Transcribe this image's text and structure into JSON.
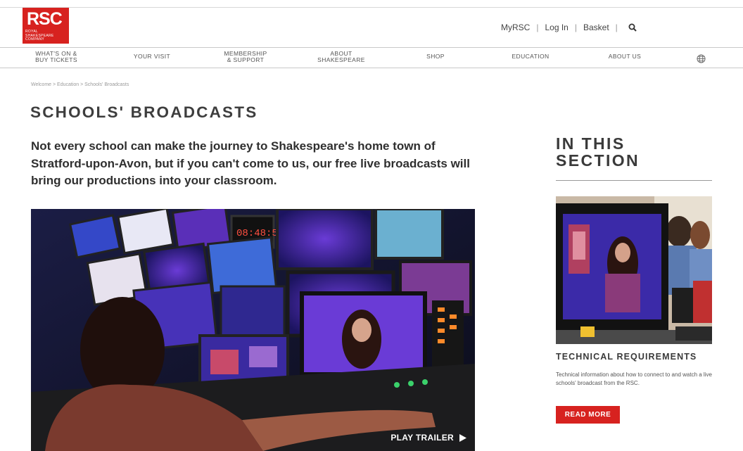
{
  "brand": {
    "logo_mark": "RSC",
    "logo_full": [
      "ROYAL",
      "SHAKESPEARE",
      "COMPANY"
    ],
    "accent": "#d7221f"
  },
  "utility_nav": {
    "myrsc": "MyRSC",
    "login": "Log In",
    "basket": "Basket",
    "search_icon": "search-icon"
  },
  "main_nav": {
    "items": [
      {
        "label_1": "WHAT'S ON &",
        "label_2": "BUY TICKETS"
      },
      {
        "label_1": "YOUR VISIT"
      },
      {
        "label_1": "MEMBERSHIP",
        "label_2": "& SUPPORT"
      },
      {
        "label_1": "ABOUT",
        "label_2": "SHAKESPEARE"
      },
      {
        "label_1": "SHOP"
      },
      {
        "label_1": "EDUCATION"
      },
      {
        "label_1": "ABOUT US"
      }
    ],
    "language_icon": "globe-icon"
  },
  "breadcrumb": "Welcome > Education > Schools' Broadcasts",
  "page": {
    "title": "SCHOOLS' BROADCASTS",
    "intro": "Not every school can make the journey to Shakespeare's home town of Stratford-upon-Avon, but if you can't come to us, our free live broadcasts will bring our productions into your classroom."
  },
  "hero": {
    "play_label": "PLAY TRAILER",
    "play_icon": "play-icon"
  },
  "sidebar": {
    "title_1": "IN THIS",
    "title_2": "SECTION",
    "card": {
      "title": "TECHNICAL REQUIREMENTS",
      "text": "Technical information about how to connect to and watch a live schools' broadcast from the RSC.",
      "button": "READ MORE"
    }
  }
}
